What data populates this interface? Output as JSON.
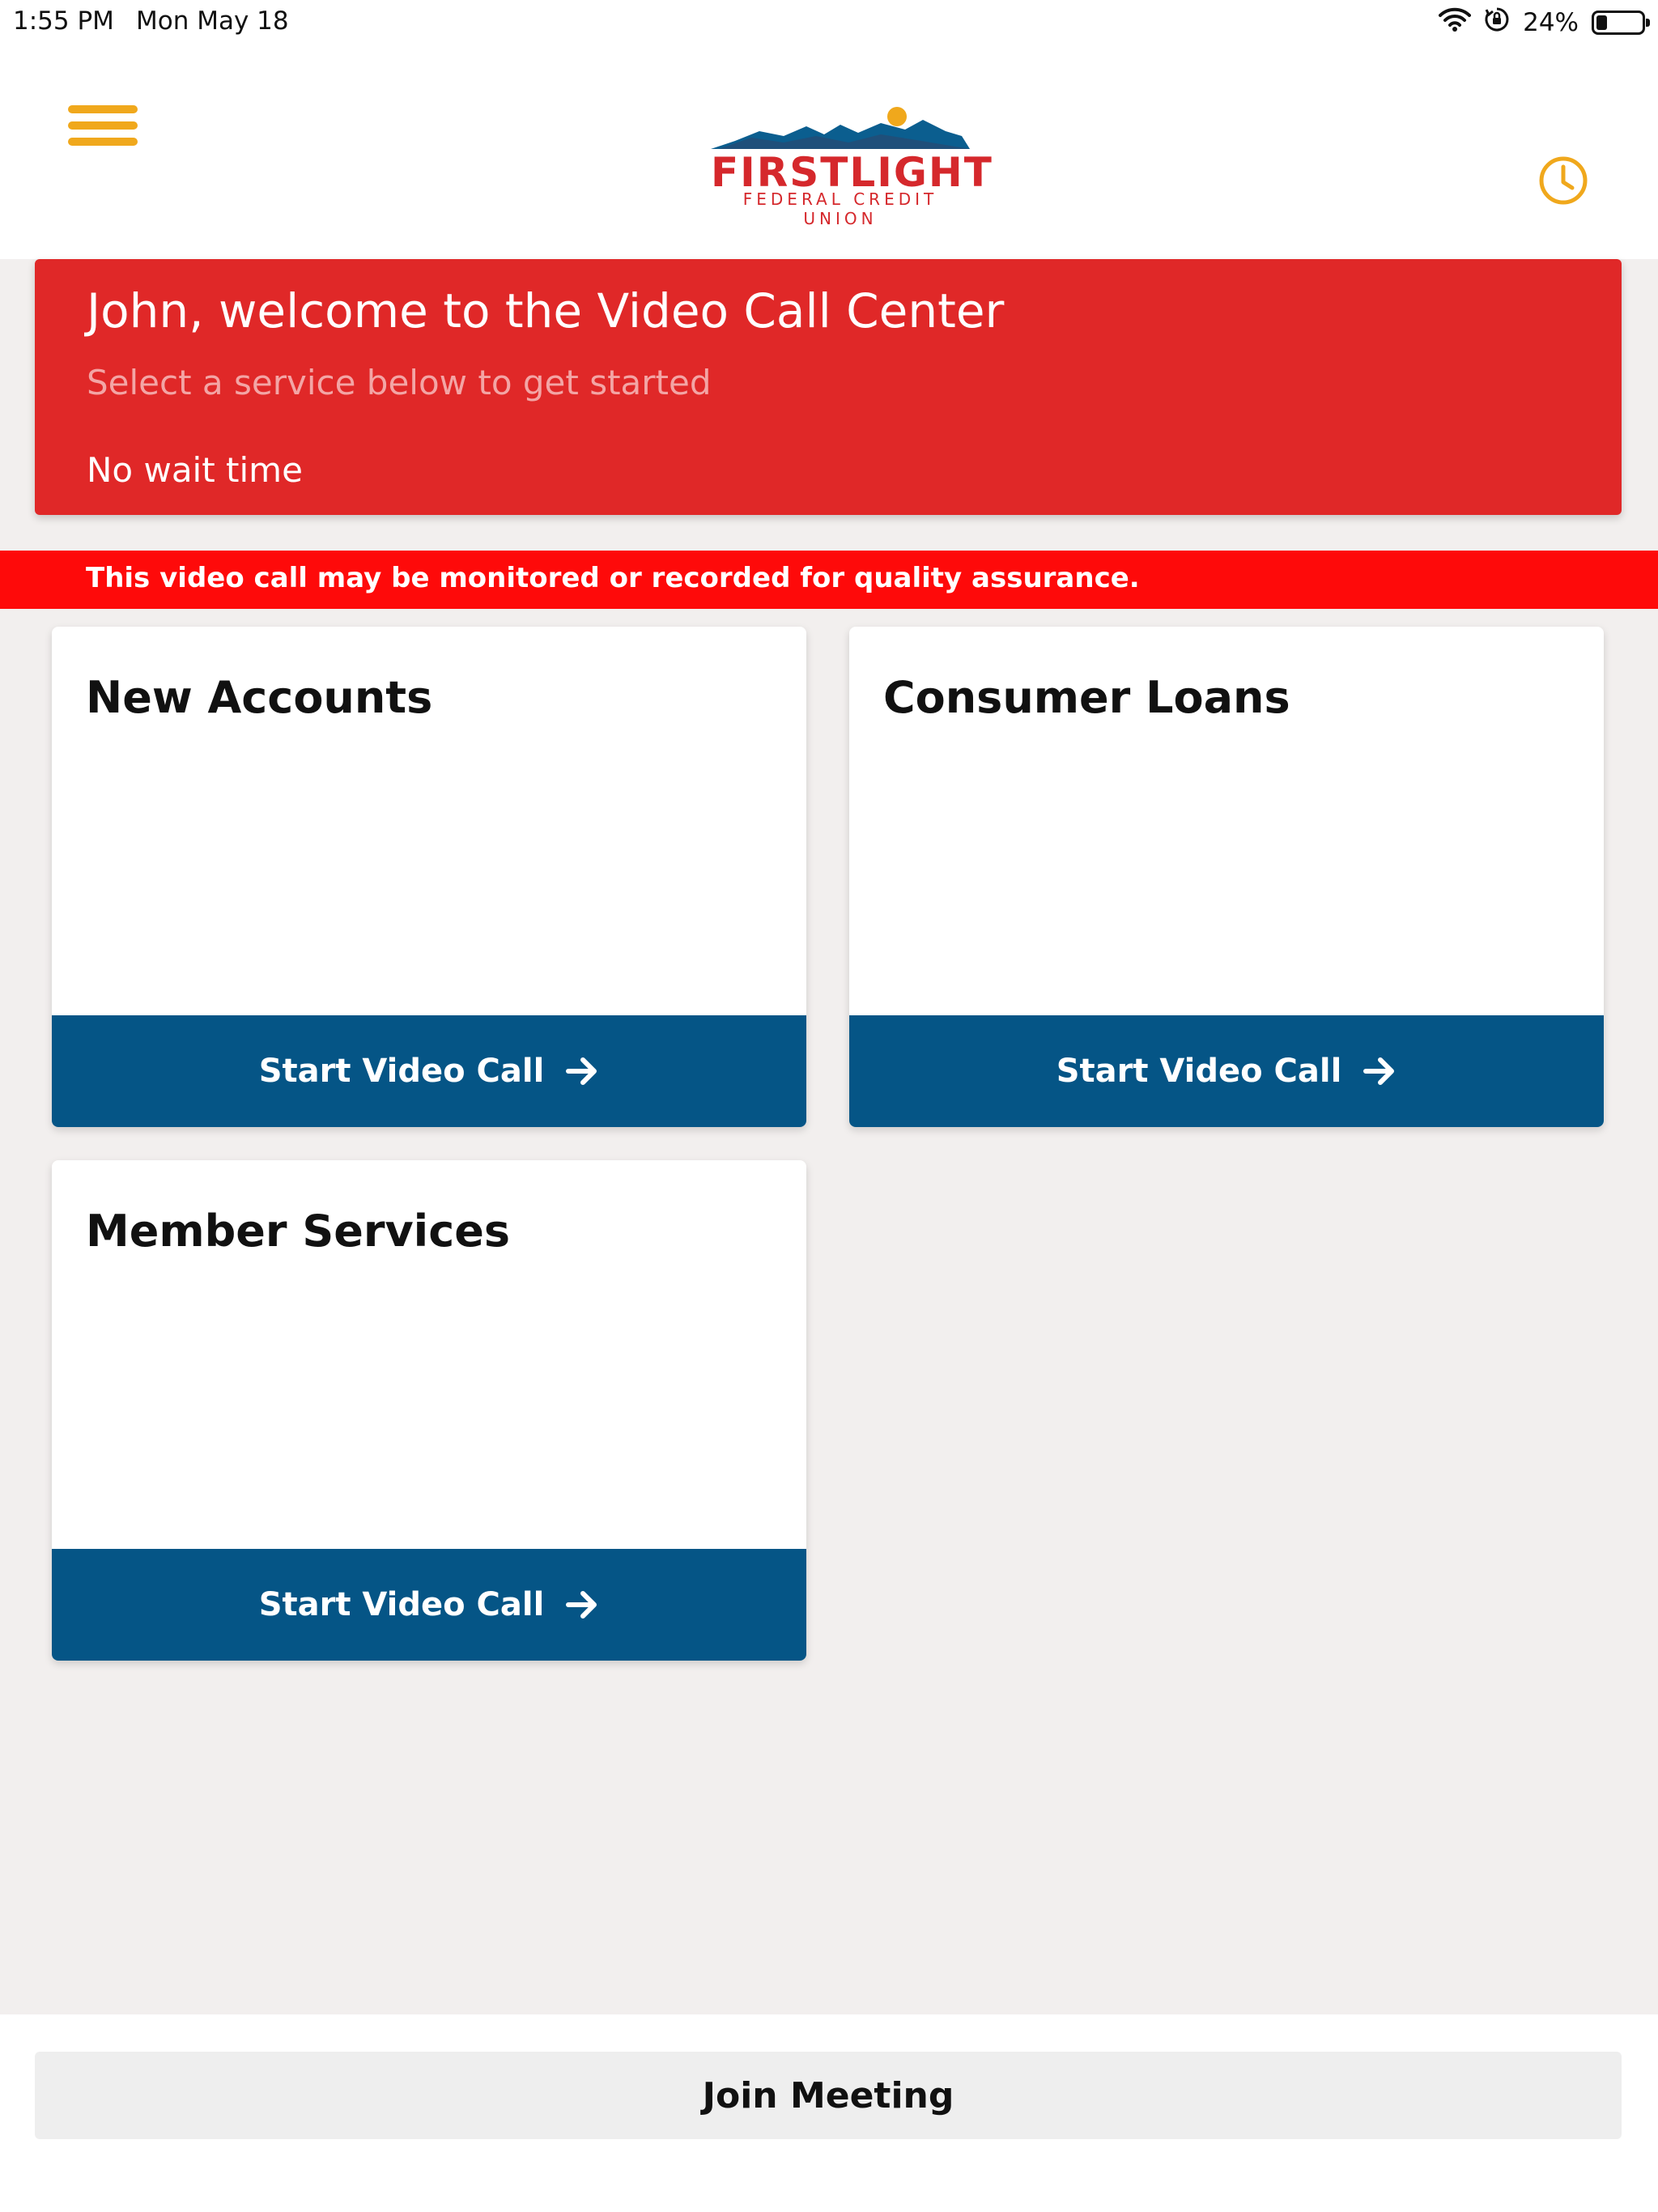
{
  "status_bar": {
    "time": "1:55 PM",
    "date": "Mon May 18",
    "battery_percent": "24%",
    "battery_level": 0.24
  },
  "header": {
    "logo_brand": "FIRSTLIGHT",
    "logo_subtitle": "FEDERAL CREDIT UNION",
    "menu_icon": "hamburger-menu-icon",
    "history_icon": "clock-icon",
    "accent_color": "#f0a81c"
  },
  "welcome": {
    "title": "John, welcome to the Video Call Center",
    "subtitle": "Select a service below to get started",
    "wait_time": "No wait time",
    "color": "#e02828"
  },
  "notice": {
    "text": "This video call may be monitored or recorded for quality assurance.",
    "color": "#fe0a0a"
  },
  "services": [
    {
      "title": "New Accounts",
      "button_label": "Start Video Call"
    },
    {
      "title": "Consumer Loans",
      "button_label": "Start Video Call"
    },
    {
      "title": "Member Services",
      "button_label": "Start Video Call"
    }
  ],
  "button_color": "#055586",
  "footer": {
    "join_label": "Join Meeting"
  }
}
